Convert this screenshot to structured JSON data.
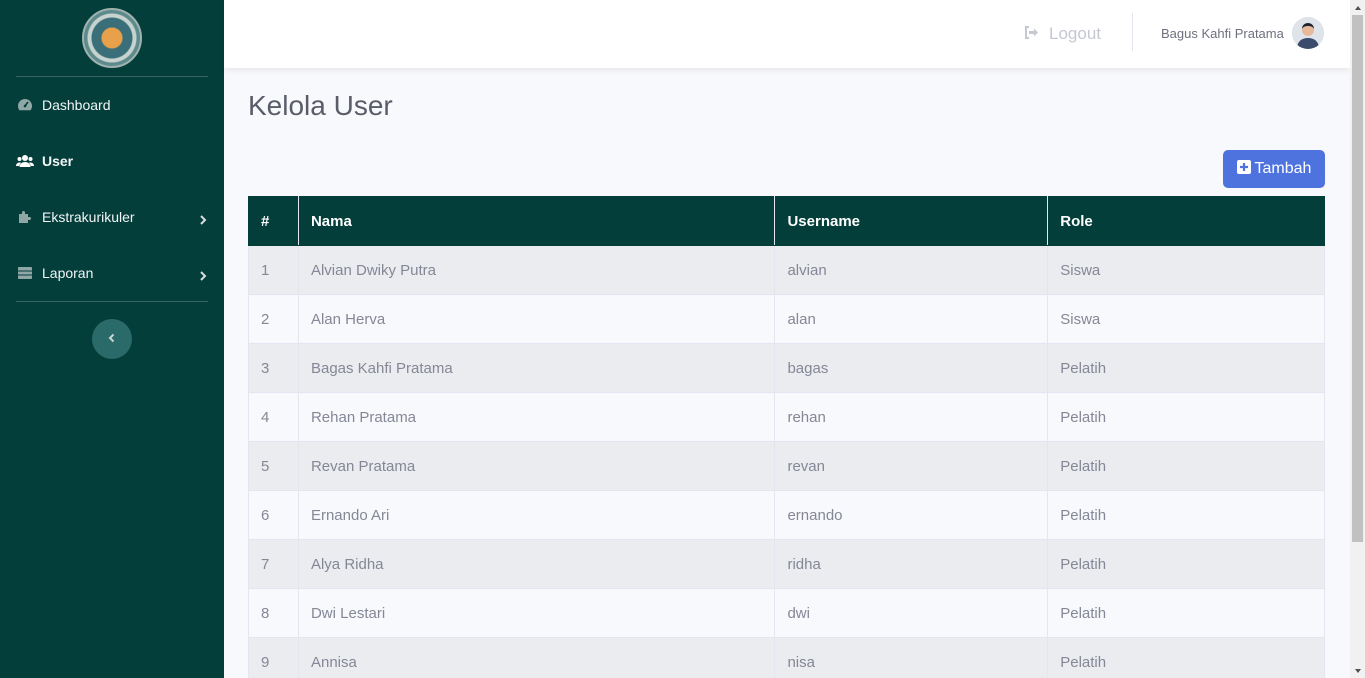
{
  "sidebar": {
    "items": [
      {
        "label": "Dashboard",
        "icon": "gauge-icon"
      },
      {
        "label": "User",
        "icon": "users-icon"
      },
      {
        "label": "Ekstrakurikuler",
        "icon": "puzzle-icon"
      },
      {
        "label": "Laporan",
        "icon": "table-icon"
      }
    ]
  },
  "topbar": {
    "logout_label": "Logout",
    "user_name": "Bagus Kahfi Pratama"
  },
  "page": {
    "title": "Kelola User",
    "add_button_label": "Tambah"
  },
  "table": {
    "headers": [
      "#",
      "Nama",
      "Username",
      "Role"
    ],
    "rows": [
      [
        "1",
        "Alvian Dwiky Putra",
        "alvian",
        "Siswa"
      ],
      [
        "2",
        "Alan Herva",
        "alan",
        "Siswa"
      ],
      [
        "3",
        "Bagas Kahfi Pratama",
        "bagas",
        "Pelatih"
      ],
      [
        "4",
        "Rehan Pratama",
        "rehan",
        "Pelatih"
      ],
      [
        "5",
        "Revan Pratama",
        "revan",
        "Pelatih"
      ],
      [
        "6",
        "Ernando Ari",
        "ernando",
        "Pelatih"
      ],
      [
        "7",
        "Alya Ridha",
        "ridha",
        "Pelatih"
      ],
      [
        "8",
        "Dwi Lestari",
        "dwi",
        "Pelatih"
      ],
      [
        "9",
        "Annisa",
        "nisa",
        "Pelatih"
      ]
    ]
  },
  "colors": {
    "sidebar_bg": "#033e3b",
    "primary": "#4e73df",
    "table_header_bg": "#033e3b"
  }
}
